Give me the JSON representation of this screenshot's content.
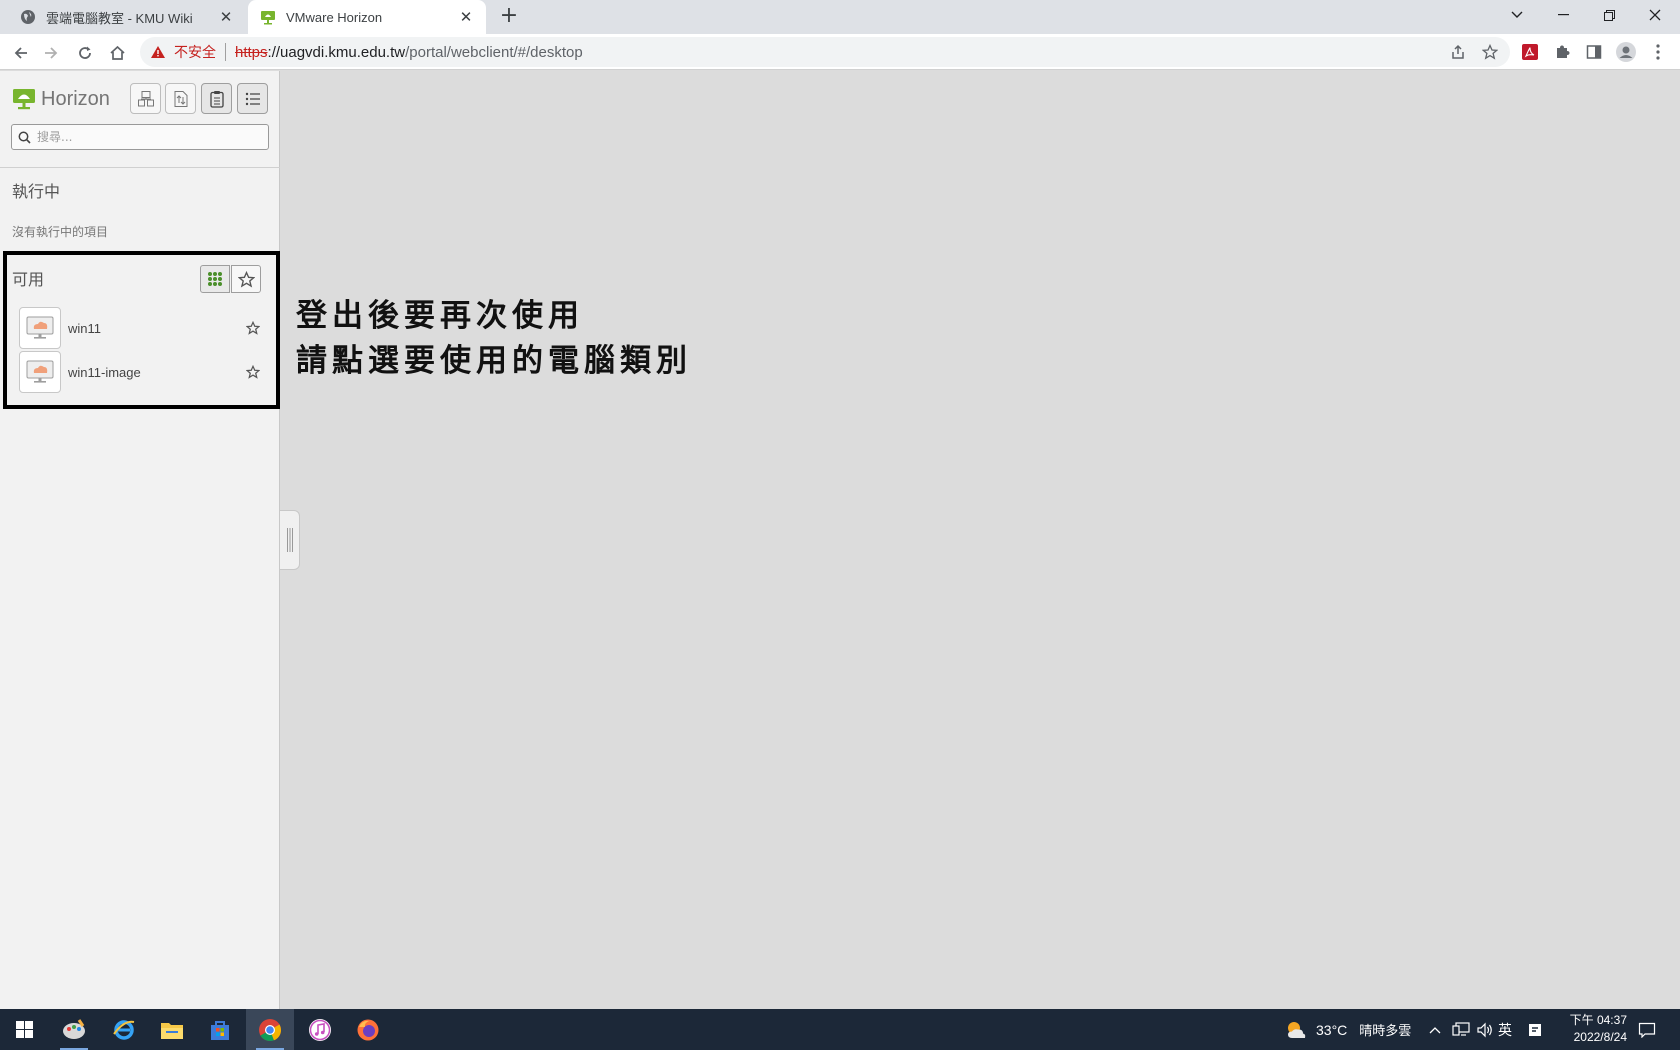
{
  "browser": {
    "tabs": [
      {
        "title": "雲端電腦教室 - KMU Wiki",
        "close": "✕"
      },
      {
        "title": "VMware Horizon",
        "close": "✕"
      }
    ],
    "new_tab": "+",
    "address": {
      "warning_label": "不安全",
      "scheme": "https",
      "host": "://uagvdi.kmu.edu.tw",
      "path": "/portal/webclient/#/desktop"
    }
  },
  "horizon": {
    "logo_text": "Horizon",
    "search_placeholder": "搜尋...",
    "running_title": "執行中",
    "running_empty": "沒有執行中的項目",
    "available_title": "可用",
    "items": [
      {
        "name": "win11"
      },
      {
        "name": "win11-image"
      }
    ]
  },
  "annotation": {
    "line1": "登出後要再次使用",
    "line2": "請點選要使用的電腦類別"
  },
  "taskbar": {
    "weather_temp": "33°C",
    "weather_desc": "晴時多雲",
    "ime": "英",
    "time": "下午 04:37",
    "date": "2022/8/24"
  },
  "colors": {
    "horizon_green": "#78b52e",
    "warning_red": "#c5221f",
    "taskbar_bg": "#1c2838"
  }
}
